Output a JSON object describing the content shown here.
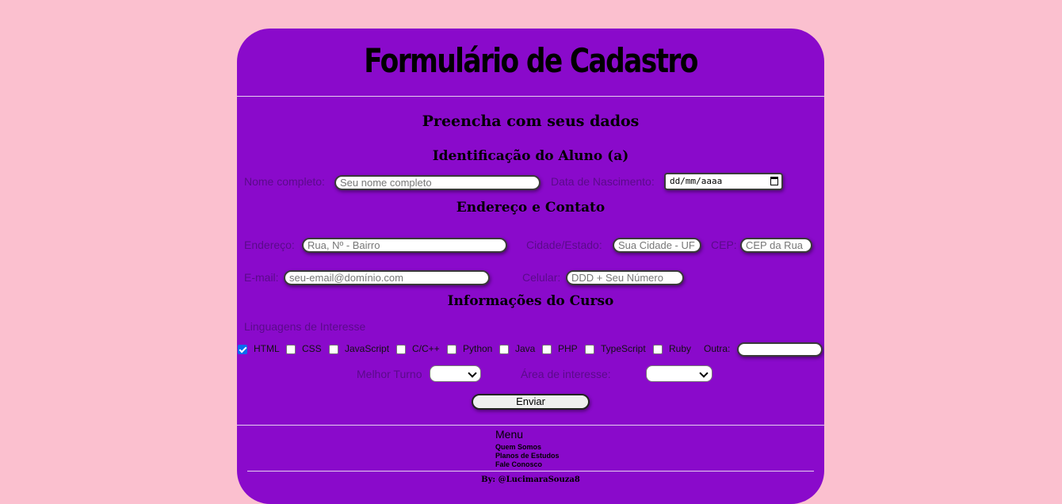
{
  "header": {
    "title": "Formulário de Cadastro",
    "subtitle": "Preencha com seus dados"
  },
  "identification": {
    "heading": "Identificação do Aluno (a)",
    "name_label": "Nome completo:",
    "name_placeholder": "Seu nome completo",
    "birth_label": "Data de Nascimento:",
    "birth_value": "dd/mm/aaaa"
  },
  "address": {
    "heading": "Endereço e Contato",
    "street_label": "Endereço:",
    "street_placeholder": "Rua, Nº - Bairro",
    "city_label": "Cidade/Estado:",
    "city_placeholder": "Sua Cidade - UF",
    "cep_label": "CEP:",
    "cep_placeholder": "CEP da Rua",
    "email_label": "E-mail:",
    "email_placeholder": "seu-email@domínio.com",
    "phone_label": "Celular:",
    "phone_placeholder": "DDD + Seu Número"
  },
  "course": {
    "heading": "Informações do Curso",
    "languages_label": "Linguagens de Interesse",
    "languages": [
      {
        "label": "HTML",
        "checked": true
      },
      {
        "label": "CSS",
        "checked": false
      },
      {
        "label": "JavaScript",
        "checked": false
      },
      {
        "label": "C/C++",
        "checked": false
      },
      {
        "label": "Python",
        "checked": false
      },
      {
        "label": "Java",
        "checked": false
      },
      {
        "label": "PHP",
        "checked": false
      },
      {
        "label": "TypeScript",
        "checked": false
      },
      {
        "label": "Ruby",
        "checked": false
      }
    ],
    "other_label": "Outra:",
    "other_value": "",
    "shift_label": "Melhor Turno",
    "shift_value": "",
    "area_label": "Área de interesse:",
    "area_value": ""
  },
  "submit_label": "Enviar",
  "footer": {
    "menu_title": "Menu",
    "links": [
      "Quem Somos",
      "Planos de Estudos",
      "Fale Conosco"
    ],
    "byline": "By: @LucimaraSouza8"
  },
  "colors": {
    "page_background": "#fbc0cf",
    "card_background": "#8a0acb",
    "label_color": "#5a0a8a",
    "checkbox_checked": "#0a6cf0"
  }
}
